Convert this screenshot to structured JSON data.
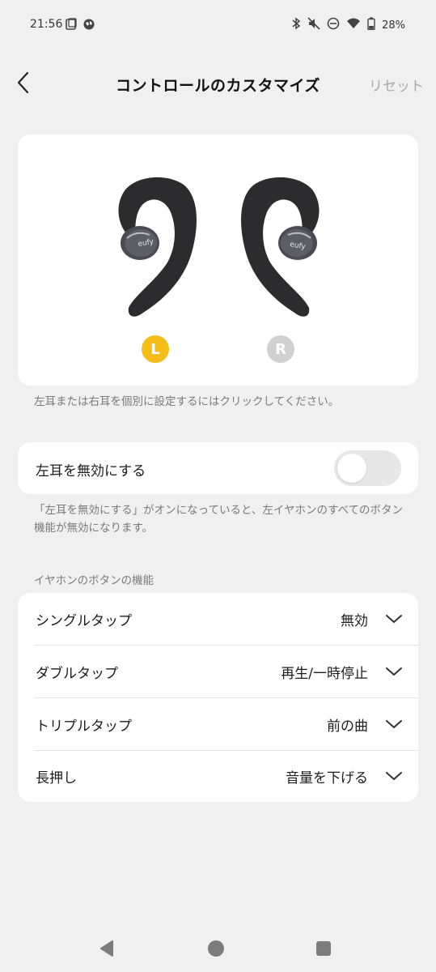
{
  "status_bar": {
    "time": "21:56",
    "battery": "28%",
    "icons": [
      "square-notification-icon",
      "globe-icon",
      "bluetooth-icon",
      "mute-icon",
      "do-not-disturb-icon",
      "wifi-icon",
      "battery-icon"
    ]
  },
  "header": {
    "back_icon": "chevron-left-icon",
    "title": "コントロールのカスタマイズ",
    "reset_label": "リセット"
  },
  "earbuds": {
    "left_badge": "L",
    "right_badge": "R",
    "left_selected": true,
    "brand_text": "eufy",
    "selected_color": "#f6bd19",
    "unselected_color": "#d0d0d0"
  },
  "hint": "左耳または右耳を個別に設定するにはクリックしてください。",
  "disable_toggle": {
    "label": "左耳を無効にする",
    "enabled": false,
    "description": "「左耳を無効にする」がオンになっていると、左イヤホンのすべてのボタン機能が無効になります。"
  },
  "functions": {
    "section_title": "イヤホンのボタンの機能",
    "rows": [
      {
        "label": "シングルタップ",
        "value": "無効"
      },
      {
        "label": "ダブルタップ",
        "value": "再生/一時停止"
      },
      {
        "label": "トリプルタップ",
        "value": "前の曲"
      },
      {
        "label": "長押し",
        "value": "音量を下げる"
      }
    ]
  },
  "nav_bar": {
    "icons": [
      "back-triangle-icon",
      "home-circle-icon",
      "recent-apps-square-icon"
    ]
  }
}
